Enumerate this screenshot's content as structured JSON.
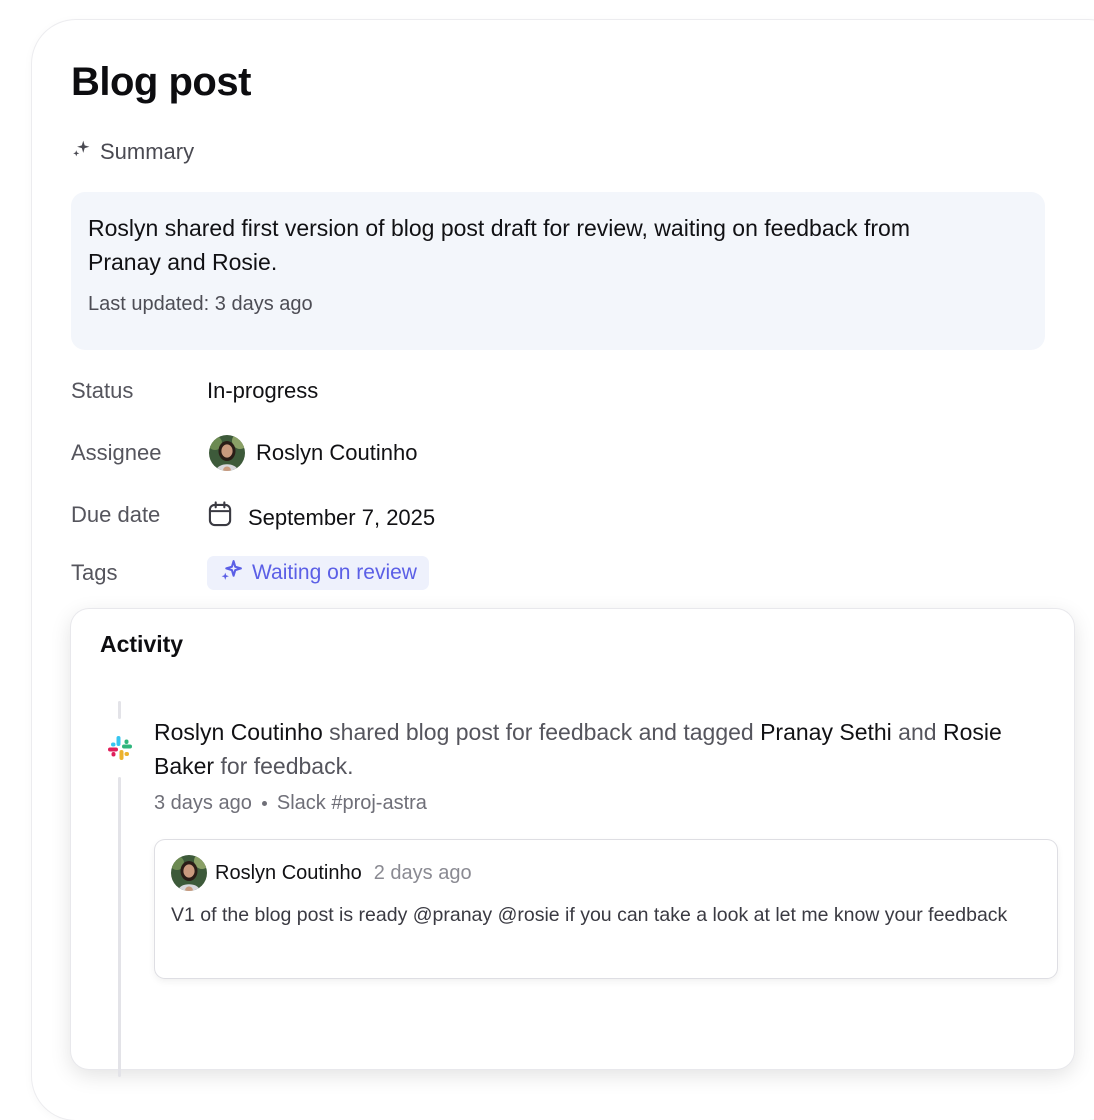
{
  "page": {
    "title": "Blog post"
  },
  "summary": {
    "header": "Summary",
    "text": "Roslyn shared first version of blog post draft for review, waiting on feedback from Pranay and Rosie.",
    "last_updated": "Last updated: 3 days ago"
  },
  "properties": {
    "status": {
      "label": "Status",
      "value": "In-progress"
    },
    "assignee": {
      "label": "Assignee",
      "value": "Roslyn Coutinho"
    },
    "due_date": {
      "label": "Due date",
      "value": "September 7, 2025"
    },
    "tags": {
      "label": "Tags",
      "value": "Waiting on review"
    }
  },
  "activity": {
    "title": "Activity",
    "event": {
      "actor": "Roslyn Coutinho",
      "text1": " shared blog post for feedback and tagged ",
      "mention1": "Pranay Sethi",
      "text2": " and ",
      "mention2": "Rosie Baker",
      "text3": " for feedback.",
      "time": "3 days ago",
      "source": "Slack #proj-astra"
    },
    "comment": {
      "author": "Roslyn Coutinho",
      "time": "2 days ago",
      "body": "V1 of the blog post is ready @pranay @rosie if you can take a look at let me know your feedback"
    }
  },
  "colors": {
    "accent": "#5b5fe6",
    "summary_bg": "#f3f6fb",
    "tag_bg": "#eef1fc"
  },
  "icons": {
    "summary": "sparkle-icon",
    "calendar": "calendar-icon",
    "tag": "sparkle-icon",
    "source": "slack-icon"
  }
}
